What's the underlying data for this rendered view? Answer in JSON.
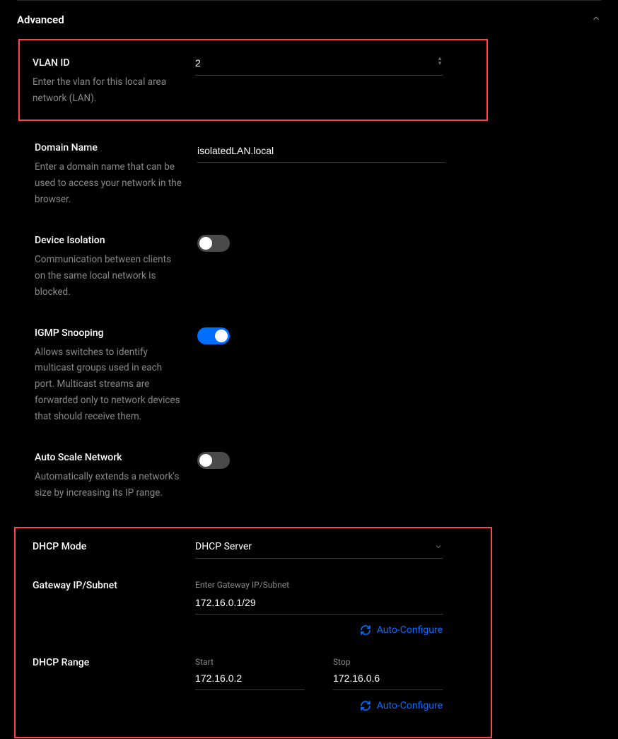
{
  "section": {
    "title": "Advanced"
  },
  "vlan": {
    "label": "VLAN ID",
    "desc": "Enter the vlan for this local area network (LAN).",
    "value": "2"
  },
  "domain": {
    "label": "Domain Name",
    "desc": "Enter a domain name that can be used to access your network in the browser.",
    "value": "isolatedLAN.local"
  },
  "isolation": {
    "label": "Device Isolation",
    "desc": "Communication between clients on the same local network is blocked.",
    "on": false
  },
  "igmp": {
    "label": "IGMP Snooping",
    "desc": "Allows switches to identify multicast groups used in each port. Multicast streams are forwarded only to network devices that should receive them.",
    "on": true
  },
  "autoscale": {
    "label": "Auto Scale Network",
    "desc": "Automatically extends a network's size by increasing its IP range.",
    "on": false
  },
  "dhcpMode": {
    "label": "DHCP Mode",
    "value": "DHCP Server"
  },
  "gateway": {
    "label": "Gateway IP/Subnet",
    "placeholder": "Enter Gateway IP/Subnet",
    "value": "172.16.0.1/29",
    "autoConfigure": "Auto-Configure"
  },
  "dhcpRange": {
    "label": "DHCP Range",
    "startLabel": "Start",
    "stopLabel": "Stop",
    "start": "172.16.0.2",
    "stop": "172.16.0.6",
    "autoConfigure": "Auto-Configure"
  }
}
